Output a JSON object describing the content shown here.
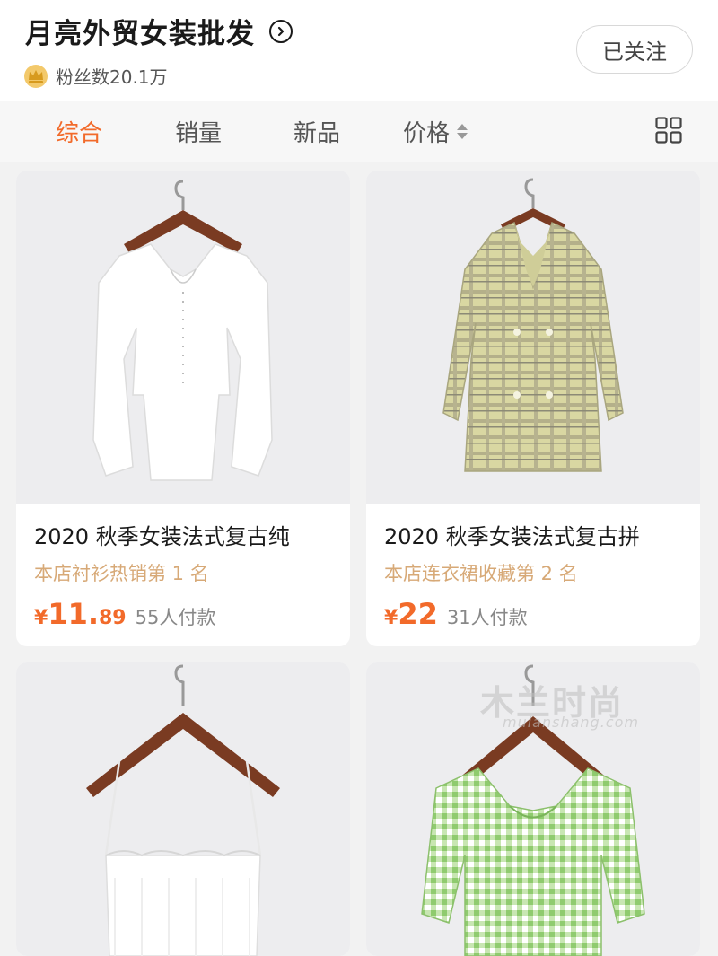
{
  "header": {
    "shop_name": "月亮外贸女装批发",
    "fans": "粉丝数20.1万",
    "follow_label": "已关注"
  },
  "sortbar": {
    "tabs": [
      {
        "label": "综合",
        "active": true
      },
      {
        "label": "销量",
        "active": false
      },
      {
        "label": "新品",
        "active": false
      },
      {
        "label": "价格",
        "active": false
      }
    ]
  },
  "products": [
    {
      "title": "2020 秋季女装法式复古纯",
      "rank": "本店衬衫热销第 1 名",
      "price_symbol": "¥",
      "price_int": "11.",
      "price_dec": "89",
      "sold": "55人付款"
    },
    {
      "title": "2020 秋季女装法式复古拼",
      "rank": "本店连衣裙收藏第 2 名",
      "price_symbol": "¥",
      "price_int": "22",
      "price_dec": "",
      "sold": "31人付款"
    },
    {
      "title": "",
      "rank": "",
      "price_symbol": "",
      "price_int": "",
      "price_dec": "",
      "sold": ""
    },
    {
      "title": "",
      "rank": "",
      "price_symbol": "",
      "price_int": "",
      "price_dec": "",
      "sold": ""
    }
  ],
  "watermark": {
    "text": "木兰时尚",
    "sub": "mulanshang.com"
  },
  "colors": {
    "accent": "#f26a2a",
    "rank": "#d7a977"
  }
}
